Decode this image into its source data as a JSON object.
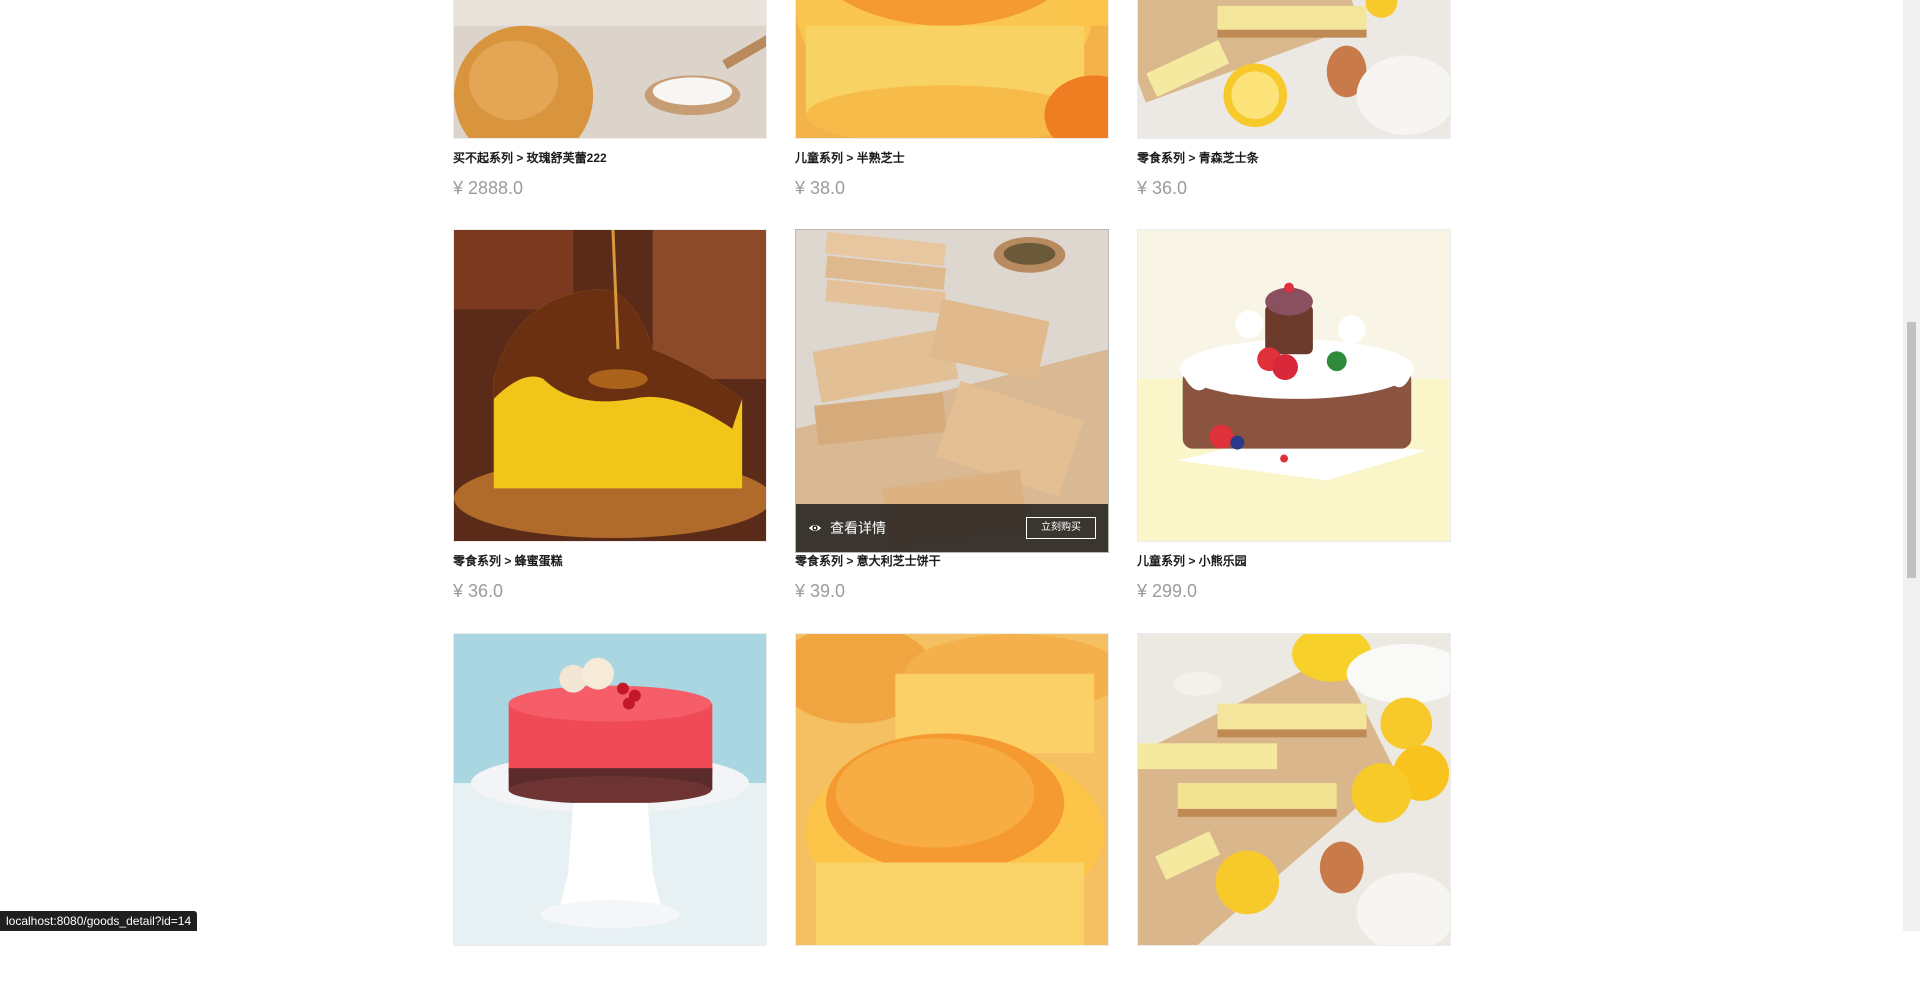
{
  "currency_symbol": "¥",
  "products": [
    {
      "title": "买不起系列 > 玫瑰舒芙蕾222",
      "price": "¥ 2888.0",
      "image": "macaron-photo"
    },
    {
      "title": "儿童系列 > 半熟芝士",
      "price": "¥ 38.0",
      "image": "cheese-tart-photo"
    },
    {
      "title": "零食系列 > 青森芝士条",
      "price": "¥ 36.0",
      "image": "cheese-bar-photo"
    },
    {
      "title": "零食系列 > 蜂蜜蛋糕",
      "price": "¥ 36.0",
      "image": "honey-cake-photo"
    },
    {
      "title": "零食系列 > 意大利芝士饼干",
      "price": "¥ 39.0",
      "image": "cheese-cookie-photo"
    },
    {
      "title": "儿童系列 > 小熊乐园",
      "price": "¥ 299.0",
      "image": "bear-cake-photo"
    },
    {
      "title": "",
      "price": "",
      "image": "red-mousse-cake-photo"
    },
    {
      "title": "",
      "price": "",
      "image": "cheese-tart-photo"
    },
    {
      "title": "",
      "price": "",
      "image": "cheese-bar-photo"
    }
  ],
  "hover_overlay": {
    "view_detail_label": "查看详情",
    "buy_now_label": "立刻购买",
    "icon": "eye-icon"
  },
  "status_bar": {
    "url": "localhost:8080/goods_detail?id=14"
  },
  "colors": {
    "price": "#9b9b9b",
    "title": "#1a1a1a",
    "overlay": "#191919"
  }
}
